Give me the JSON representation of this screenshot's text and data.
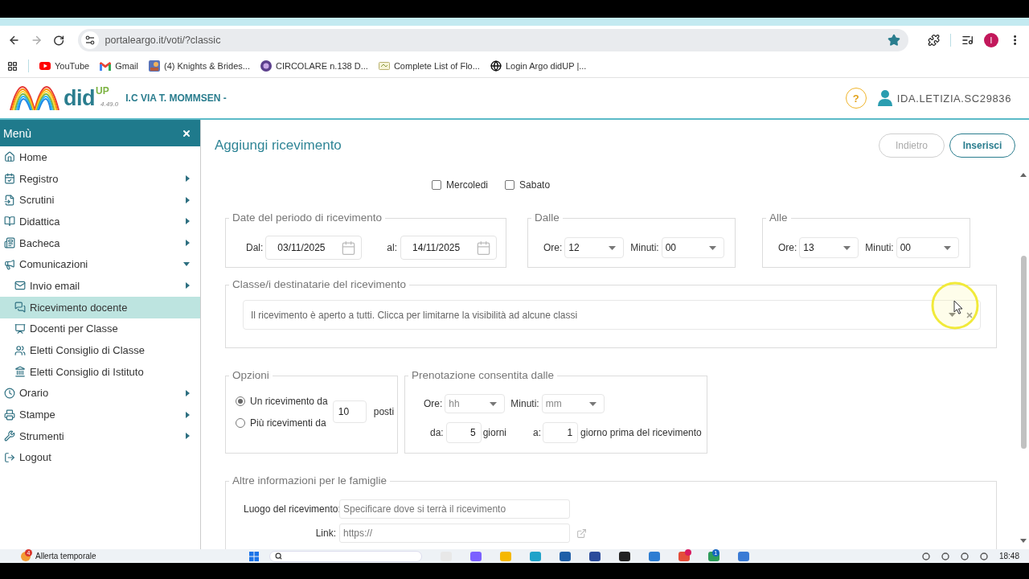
{
  "browser": {
    "url": "portaleargo.it/voti/?classic",
    "bookmarked": true,
    "profile_initial": "I",
    "bookmarks": [
      {
        "label": "YouTube"
      },
      {
        "label": "Gmail"
      },
      {
        "label": "(4) Knights & Brides..."
      },
      {
        "label": "CIRCOLARE n.138 D..."
      },
      {
        "label": "Complete List of Flo..."
      },
      {
        "label": "Login Argo didUP |..."
      }
    ]
  },
  "header": {
    "logo_text": "did",
    "logo_superscript": "UP",
    "version": "4.49.0",
    "school": "I.C VIA T. MOMMSEN -",
    "help": "?",
    "user": "IDA.LETIZIA.SC29836"
  },
  "sidebar": {
    "title": "Menù",
    "items": [
      {
        "label": "Home",
        "kind": "link",
        "selected": false
      },
      {
        "label": "Registro",
        "kind": "submenu",
        "expanded": false,
        "selected": false
      },
      {
        "label": "Scrutini",
        "kind": "submenu",
        "expanded": false,
        "selected": false
      },
      {
        "label": "Didattica",
        "kind": "submenu",
        "expanded": false,
        "selected": false
      },
      {
        "label": "Bacheca",
        "kind": "submenu",
        "expanded": false,
        "selected": false
      },
      {
        "label": "Comunicazioni",
        "kind": "submenu",
        "expanded": true,
        "selected": false,
        "children": [
          {
            "label": "Invio email",
            "kind": "submenu",
            "expanded": false,
            "selected": false
          },
          {
            "label": "Ricevimento docente",
            "kind": "link",
            "selected": true
          },
          {
            "label": "Docenti per Classe",
            "kind": "link",
            "selected": false
          },
          {
            "label": "Eletti Consiglio di Classe",
            "kind": "link",
            "selected": false
          },
          {
            "label": "Eletti Consiglio di Istituto",
            "kind": "link",
            "selected": false
          }
        ]
      },
      {
        "label": "Orario",
        "kind": "submenu",
        "expanded": false,
        "selected": false
      },
      {
        "label": "Stampe",
        "kind": "submenu",
        "expanded": false,
        "selected": false
      },
      {
        "label": "Strumenti",
        "kind": "submenu",
        "expanded": false,
        "selected": false
      },
      {
        "label": "Logout",
        "kind": "link",
        "selected": false
      }
    ]
  },
  "page": {
    "title": "Aggiungi ricevimento",
    "buttons": [
      {
        "label": "Indietro",
        "disabled": true
      },
      {
        "label": "Inserisci",
        "disabled": false
      }
    ]
  },
  "weekdays": [
    {
      "label": "Mercoledi",
      "checked": false
    },
    {
      "label": "Sabato",
      "checked": false
    }
  ],
  "period": {
    "legend": "Date del periodo di ricevimento",
    "from_label": "Dal:",
    "from": "03/11/2025",
    "to_label": "al:",
    "to": "14/11/2025"
  },
  "time_ranges": [
    {
      "legend": "Dalle",
      "hours_label": "Ore:",
      "hours": "12",
      "minutes_label": "Minuti:",
      "minutes": "00"
    },
    {
      "legend": "Alle",
      "hours_label": "Ore:",
      "hours": "13",
      "minutes_label": "Minuti:",
      "minutes": "00"
    }
  ],
  "classes": {
    "legend": "Classe/i destinatarie del ricevimento",
    "placeholder": "Il ricevimento è aperto a tutti. Clicca per limitarne la visibilità ad alcune classi"
  },
  "options": {
    "legend": "Opzioni",
    "choices": [
      {
        "label": "Un ricevimento da",
        "selected": true
      },
      {
        "label": "Più ricevimenti da",
        "selected": false
      }
    ],
    "seats": "10",
    "seats_unit": "posti"
  },
  "booking": {
    "legend": "Prenotazione consentita dalle",
    "hours_label": "Ore:",
    "hours_placeholder": "hh",
    "minutes_label": "Minuti:",
    "minutes_placeholder": "mm",
    "from_label": "da:",
    "from_days": "5",
    "from_unit": "giorni",
    "to_label": "a:",
    "to_days": "1",
    "to_unit": "giorno prima del ricevimento"
  },
  "family_info": {
    "legend": "Altre informazioni per le famiglie",
    "fields": [
      {
        "kind": "text",
        "label": "Luogo del ricevimento:",
        "placeholder": "Specificare dove si terrà il ricevimento"
      },
      {
        "kind": "link",
        "label": "Link:",
        "placeholder": "https://"
      }
    ]
  },
  "taskbar": {
    "weather_badge": "4",
    "weather": "Allerta temporale",
    "app_badge": "1",
    "time": "18:48"
  }
}
